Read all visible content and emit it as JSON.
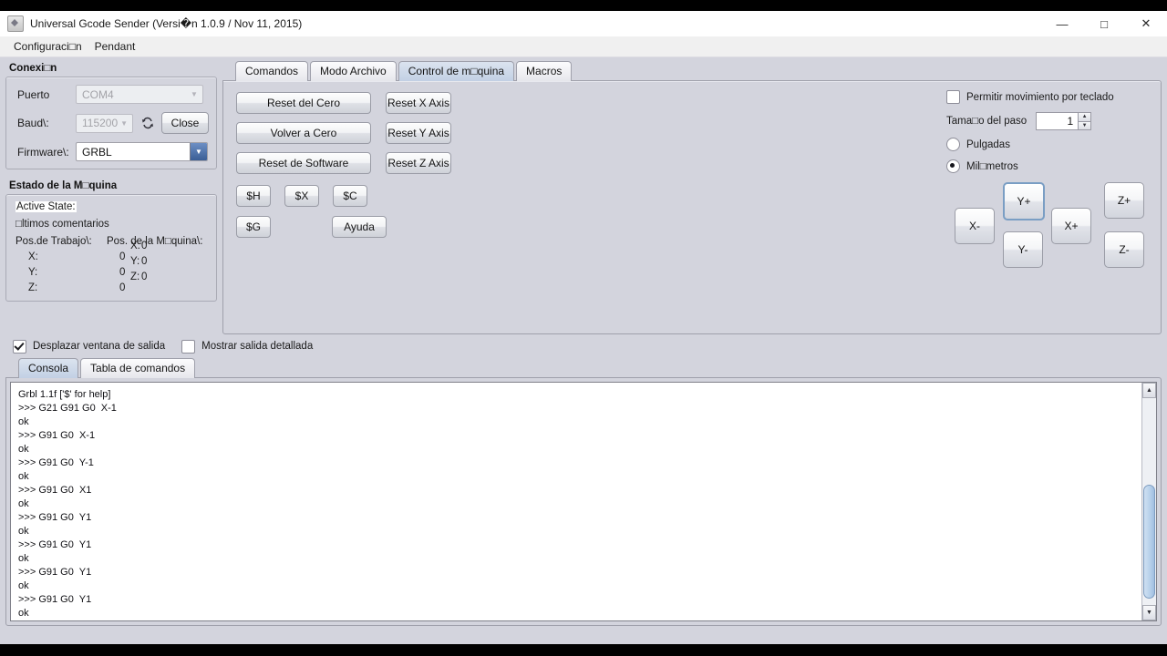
{
  "window": {
    "title": "Universal Gcode Sender (Versi�n 1.0.9 / Nov 11, 2015)",
    "minimize": "—",
    "maximize": "□",
    "close": "✕"
  },
  "menubar": {
    "items": [
      {
        "label": "Configuraci□n"
      },
      {
        "label": "Pendant"
      }
    ]
  },
  "connection": {
    "group_title": "Conexi□n",
    "port_label": "Puerto",
    "port_value": "COM4",
    "baud_label": "Baud\\:",
    "baud_value": "115200",
    "refresh_icon": "↻",
    "close_button": "Close",
    "firmware_label": "Firmware\\:",
    "firmware_value": "GRBL",
    "arrow": "▼"
  },
  "machine_status": {
    "group_title": "Estado de la M□quina",
    "active_state_label": "Active State:",
    "last_comments_label": "□ltimos comentarios",
    "work_pos_header": "Pos.de Trabajo\\:",
    "machine_pos_header": "Pos. de la M□quina\\:",
    "axes": [
      {
        "name": "X:",
        "work": "0",
        "machine": "0"
      },
      {
        "name": "Y:",
        "work": "0",
        "machine": "0"
      },
      {
        "name": "Z:",
        "work": "0",
        "machine": "0"
      }
    ]
  },
  "main_tabs": [
    {
      "label": "Comandos",
      "selected": false
    },
    {
      "label": "Modo Archivo",
      "selected": false
    },
    {
      "label": "Control de m□quina",
      "selected": true
    },
    {
      "label": "Macros",
      "selected": false
    }
  ],
  "machine_control": {
    "reset_zero": "Reset del Cero",
    "return_zero": "Volver a Cero",
    "soft_reset": "Reset de Software",
    "reset_x": "Reset X Axis",
    "reset_y": "Reset Y Axis",
    "reset_z": "Reset Z Axis",
    "cmd_h": "$H",
    "cmd_x": "$X",
    "cmd_c": "$C",
    "cmd_g": "$G",
    "help": "Ayuda"
  },
  "jog_options": {
    "keyboard_label": "Permitir movimiento por teclado",
    "keyboard_checked": false,
    "step_label": "Tama□o del paso",
    "step_value": "1",
    "spin_up": "▲",
    "spin_down": "▼",
    "inches_label": "Pulgadas",
    "inches_selected": false,
    "mm_label": "Mil□metros",
    "mm_selected": true,
    "buttons": {
      "x_minus": "X-",
      "x_plus": "X+",
      "y_plus": "Y+",
      "y_minus": "Y-",
      "z_plus": "Z+",
      "z_minus": "Z-"
    }
  },
  "output_options": {
    "scroll_label": "Desplazar ventana de salida",
    "scroll_checked": true,
    "verbose_label": "Mostrar salida detallada",
    "verbose_checked": false
  },
  "console_tabs": [
    {
      "label": "Consola",
      "selected": true
    },
    {
      "label": "Tabla de comandos",
      "selected": false
    }
  ],
  "console": {
    "text": "Grbl 1.1f ['$' for help]\n>>> G21 G91 G0  X-1\nok\n>>> G91 G0  X-1\nok\n>>> G91 G0  Y-1\nok\n>>> G91 G0  X1\nok\n>>> G91 G0  Y1\nok\n>>> G91 G0  Y1\nok\n>>> G91 G0  Y1\nok\n>>> G91 G0  Y1\nok",
    "scroll_up": "▲",
    "scroll_down": "▼"
  }
}
